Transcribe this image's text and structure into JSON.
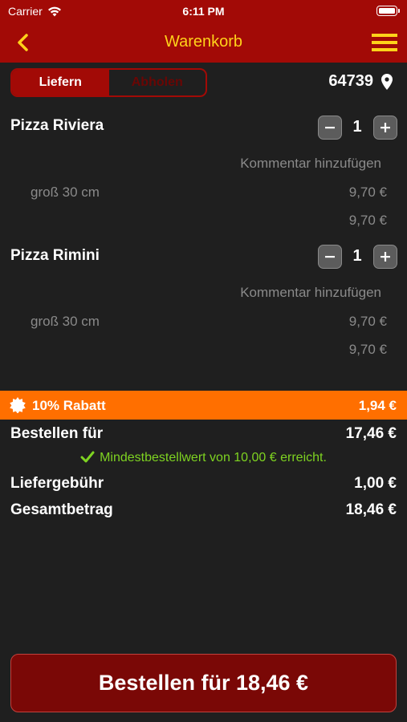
{
  "status": {
    "carrier": "Carrier",
    "time": "6:11 PM"
  },
  "nav": {
    "title": "Warenkorb",
    "back_icon": "chevron-left-icon",
    "menu_icon": "hamburger-icon"
  },
  "segment": {
    "options": [
      "Liefern",
      "Abholen"
    ],
    "selected": "Liefern"
  },
  "location": {
    "zip": "64739",
    "icon": "map-pin-icon"
  },
  "items": [
    {
      "name": "Pizza Riviera",
      "quantity": "1",
      "comment": "Kommentar hinzufügen",
      "option": "groß 30 cm",
      "option_price": "9,70 €",
      "total": "9,70 €"
    },
    {
      "name": "Pizza Rimini",
      "quantity": "1",
      "comment": "Kommentar hinzufügen",
      "option": "groß 30 cm",
      "option_price": "9,70 €",
      "total": "9,70 €"
    }
  ],
  "discount": {
    "label": "10% Rabatt",
    "value": "1,94 €",
    "color": "#ff6f00"
  },
  "summary": {
    "order_for_label": "Bestellen für",
    "order_for_value": "17,46 €",
    "minimum_text": "Mindestbestellwert von 10,00 € erreicht.",
    "delivery_label": "Liefergebühr",
    "delivery_value": "1,00 €",
    "total_label": "Gesamtbetrag",
    "total_value": "18,46 €"
  },
  "order_button": {
    "label": "Bestellen für 18,46 €"
  },
  "colors": {
    "brand_red": "#a20a06",
    "accent_yellow": "#ffd21a",
    "success_green": "#7ed321",
    "background": "#1f1f1f"
  }
}
